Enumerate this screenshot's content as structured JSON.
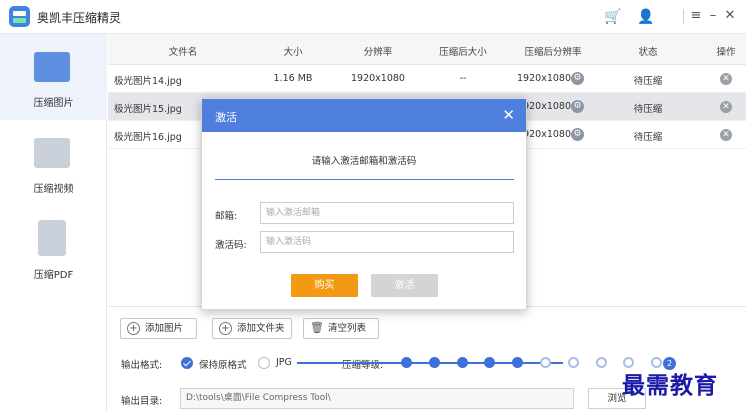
{
  "app": {
    "title": "奥凯丰压缩精灵"
  },
  "sidebar": {
    "items": [
      {
        "label": "压缩图片"
      },
      {
        "label": "压缩视频"
      },
      {
        "label": "压缩PDF"
      }
    ]
  },
  "table": {
    "headers": [
      "文件名",
      "大小",
      "分辨率",
      "压缩后大小",
      "压缩后分辨率",
      "状态",
      "操作"
    ],
    "rows": [
      {
        "name": "极光图片14.jpg",
        "size": "1.16 MB",
        "res": "1920x1080",
        "after_size": "--",
        "after_res": "1920x1080",
        "status": "待压缩"
      },
      {
        "name": "极光图片15.jpg",
        "size": "",
        "res": "",
        "after_size": "",
        "after_res": "920x1080",
        "status": "待压缩"
      },
      {
        "name": "极光图片16.jpg",
        "size": "",
        "res": "",
        "after_size": "",
        "after_res": "920x1080",
        "status": "待压缩"
      }
    ]
  },
  "bottom": {
    "add_image": "添加图片",
    "add_folder": "添加文件夹",
    "clear_list": "清空列表",
    "format_label": "输出格式:",
    "format_keep": "保持原格式",
    "format_jpg": "JPG",
    "level_label": "压缩等级:",
    "level_current": "2",
    "level_value": 5,
    "dir_label": "输出目录:",
    "dir_value": "D:\\tools\\桌面\\File Compress Tool\\",
    "browse": "浏览"
  },
  "watermark": "最需教育",
  "modal": {
    "title": "激活",
    "prompt": "请输入激活邮箱和激活码",
    "email_label": "邮箱:",
    "email_placeholder": "输入激活邮箱",
    "code_label": "激活码:",
    "code_placeholder": "输入激活码",
    "buy": "购买",
    "activate": "激活"
  }
}
